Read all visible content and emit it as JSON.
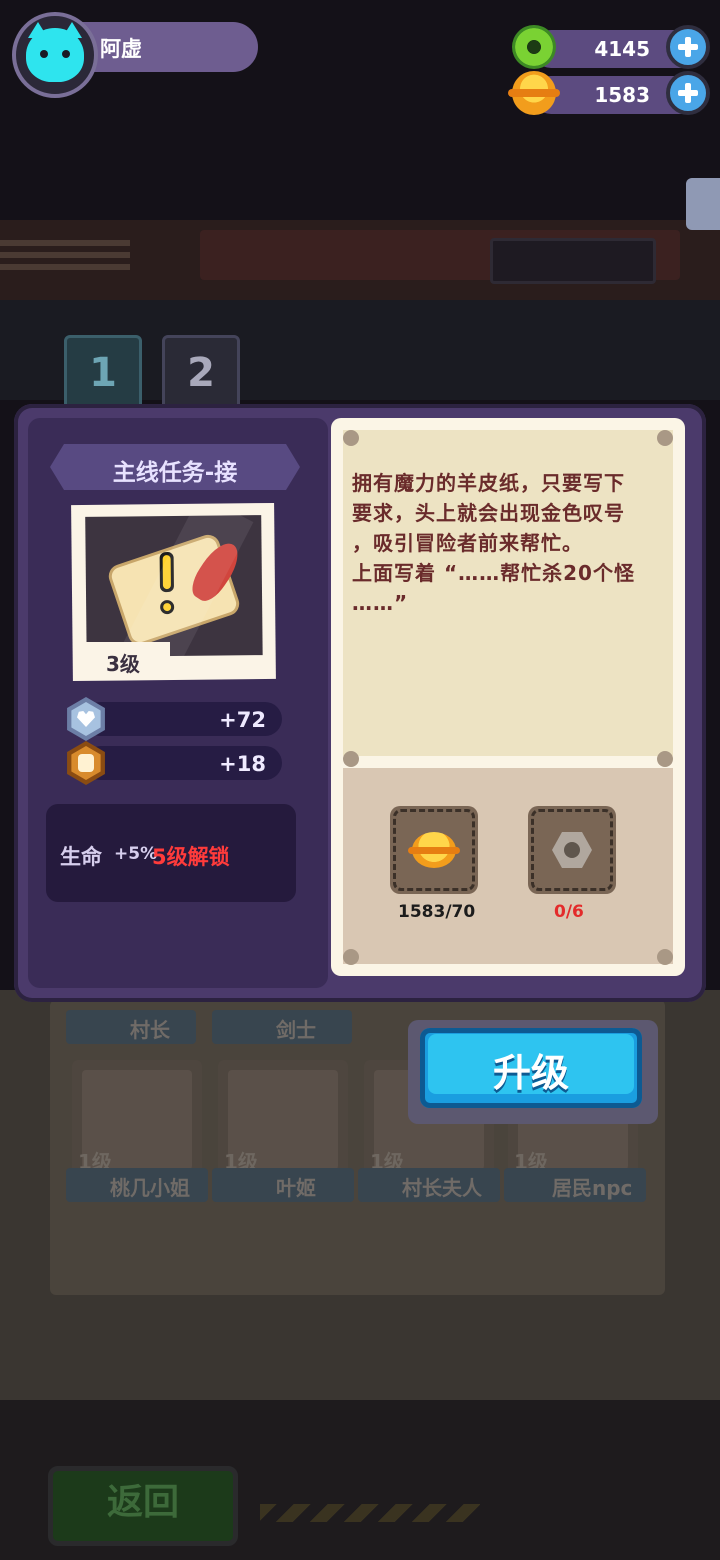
{
  "hud": {
    "player_name": "阿虚",
    "gems": "4145",
    "coins": "1583"
  },
  "tabs": [
    {
      "label": "1"
    },
    {
      "label": "2"
    }
  ],
  "background": {
    "cards_row1": [
      "村长",
      "剑士"
    ],
    "cards_row2": [
      {
        "level": "1级",
        "name": "桃几小姐"
      },
      {
        "level": "1级",
        "name": "叶姬"
      },
      {
        "level": "1级",
        "name": "村长夫人"
      },
      {
        "level": "1级",
        "name": "居民npc"
      }
    ],
    "back_label": "返回"
  },
  "item": {
    "title": "主线任务-接",
    "level": "3级",
    "stats": [
      {
        "icon": "heart-icon",
        "value": "+72"
      },
      {
        "icon": "attack-icon",
        "value": "+18"
      }
    ],
    "bonus": {
      "label": "生命",
      "value": "+5%",
      "unlock": "5级解锁"
    },
    "description": [
      "拥有魔力的羊皮纸，只要写下",
      "要求，头上就会出现金色叹号",
      "，吸引冒险者前来帮忙。",
      "上面写着 “……帮忙杀20个怪",
      "……”"
    ]
  },
  "requirements": [
    {
      "icon": "coin-icon",
      "count": "1583/70",
      "color": "#1c1c1c"
    },
    {
      "icon": "nut-icon",
      "count": "0/6",
      "color": "#e32b2b"
    }
  ],
  "upgrade_label": "升级"
}
